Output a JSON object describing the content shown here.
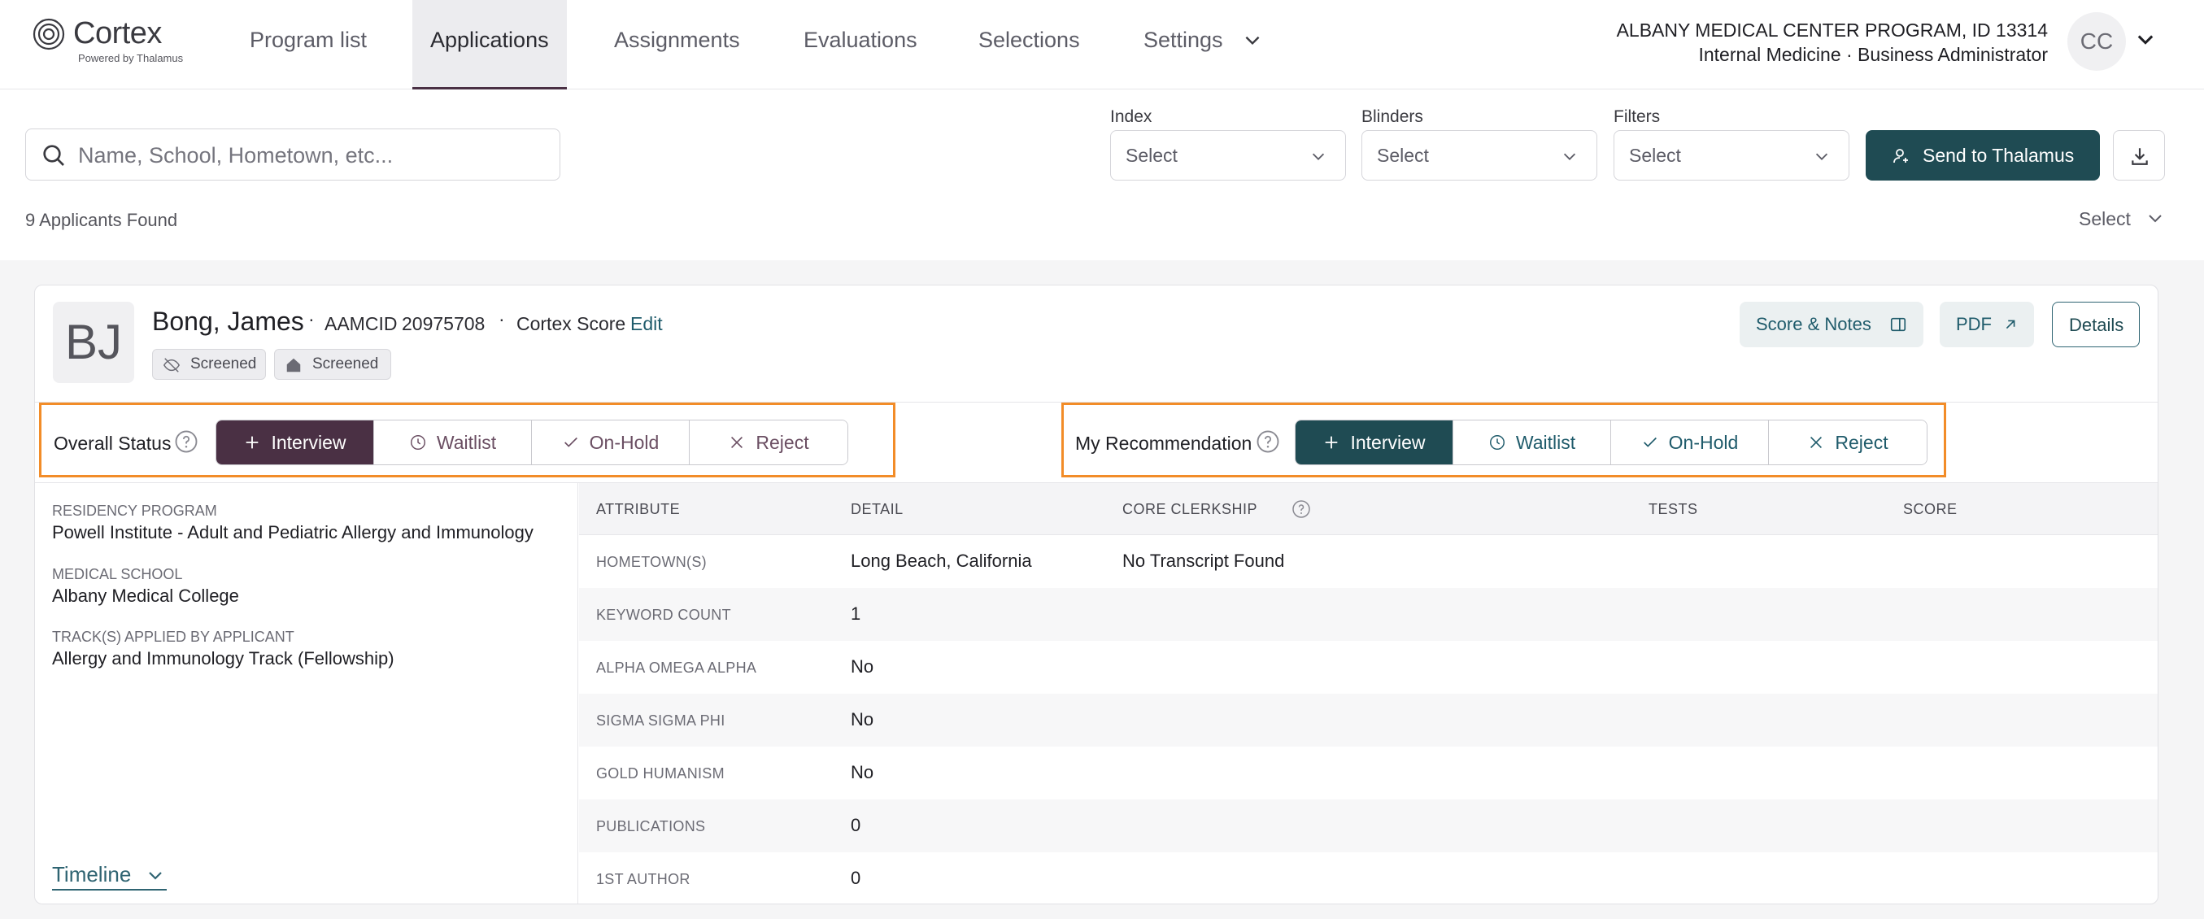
{
  "brand": {
    "name": "Cortex",
    "sub": "Powered by Thalamus"
  },
  "nav": {
    "tabs": [
      {
        "label": "Program list"
      },
      {
        "label": "Applications"
      },
      {
        "label": "Assignments"
      },
      {
        "label": "Evaluations"
      },
      {
        "label": "Selections"
      },
      {
        "label": "Settings"
      }
    ],
    "active": "Applications"
  },
  "user": {
    "org_line1": "ALBANY MEDICAL CENTER PROGRAM, ID 13314",
    "org_line2": "Internal Medicine · Business Administrator",
    "initials": "CC"
  },
  "filters": {
    "search_placeholder": "Name, School, Hometown, etc...",
    "index": {
      "label": "Index",
      "value": "Select"
    },
    "blinders": {
      "label": "Blinders",
      "value": "Select"
    },
    "filters": {
      "label": "Filters",
      "value": "Select"
    },
    "send_label": "Send to Thalamus",
    "count_text": "9 Applicants Found",
    "sort_value": "Select"
  },
  "applicant": {
    "initials": "BJ",
    "name": "Bong, James",
    "aamcid_label": "AAMCID",
    "aamcid": "20975708",
    "score_label": "Cortex Score",
    "edit_label": "Edit",
    "chips": [
      {
        "label": "Screened"
      },
      {
        "label": "Screened"
      }
    ],
    "actions": {
      "score_notes": "Score & Notes",
      "pdf": "PDF",
      "details": "Details"
    },
    "overall_status": {
      "label": "Overall Status",
      "options": [
        "Interview",
        "Waitlist",
        "On-Hold",
        "Reject"
      ],
      "selected": "Interview"
    },
    "my_recommendation": {
      "label": "My Recommendation",
      "options": [
        "Interview",
        "Waitlist",
        "On-Hold",
        "Reject"
      ],
      "selected": "Interview"
    },
    "details": [
      {
        "label": "RESIDENCY PROGRAM",
        "value": "Powell Institute - Adult and Pediatric Allergy and Immunology"
      },
      {
        "label": "MEDICAL SCHOOL",
        "value": "Albany Medical College"
      },
      {
        "label": "TRACK(S) APPLIED BY APPLICANT",
        "value": "Allergy and Immunology Track (Fellowship)"
      }
    ],
    "timeline_label": "Timeline",
    "table": {
      "headers": [
        "ATTRIBUTE",
        "DETAIL",
        "CORE CLERKSHIP",
        "TESTS",
        "SCORE"
      ],
      "rows": [
        {
          "attr": "HOMETOWN(S)",
          "detail": "Long Beach, California",
          "core": "No Transcript Found"
        },
        {
          "attr": "KEYWORD COUNT",
          "detail": "1",
          "core": ""
        },
        {
          "attr": "ALPHA OMEGA ALPHA",
          "detail": "No",
          "core": ""
        },
        {
          "attr": "SIGMA SIGMA PHI",
          "detail": "No",
          "core": ""
        },
        {
          "attr": "GOLD HUMANISM",
          "detail": "No",
          "core": ""
        },
        {
          "attr": "PUBLICATIONS",
          "detail": "0",
          "core": ""
        },
        {
          "attr": "1ST AUTHOR",
          "detail": "0",
          "core": ""
        }
      ]
    }
  },
  "colors": {
    "accent_teal": "#1f4b53",
    "accent_plum": "#4a3044",
    "highlight_orange": "#f28c28"
  }
}
